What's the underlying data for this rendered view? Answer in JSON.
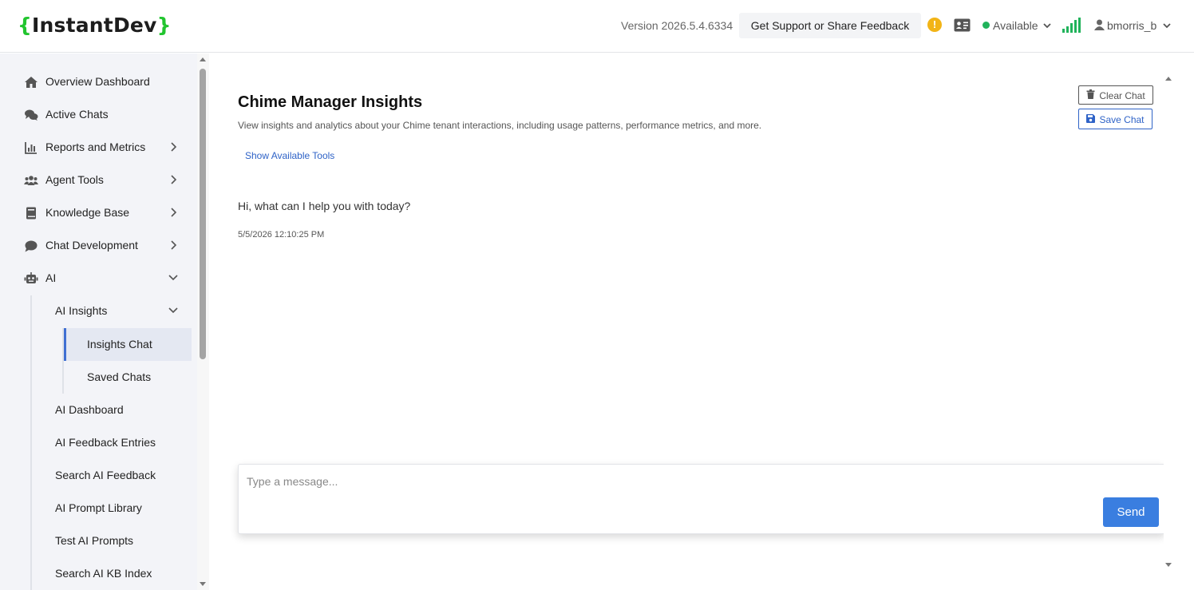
{
  "header": {
    "logo_open": "{",
    "logo_text": "InstantDev",
    "logo_close": "}",
    "version": "Version 2026.5.4.6334",
    "support_label": "Get Support or Share Feedback",
    "warn_glyph": "!",
    "status_label": "Available",
    "status_color": "#21b35b",
    "username": "bmorris_b"
  },
  "sidebar": {
    "items": [
      {
        "label": "Overview Dashboard",
        "icon": "home-icon"
      },
      {
        "label": "Active Chats",
        "icon": "chats-icon"
      },
      {
        "label": "Reports and Metrics",
        "icon": "chart-icon"
      },
      {
        "label": "Agent Tools",
        "icon": "users-icon"
      },
      {
        "label": "Knowledge Base",
        "icon": "book-icon"
      },
      {
        "label": "Chat Development",
        "icon": "comment-icon"
      },
      {
        "label": "AI",
        "icon": "robot-icon"
      }
    ],
    "ai_sub": {
      "insights_label": "AI Insights",
      "insights_children": [
        "Insights Chat",
        "Saved Chats"
      ],
      "others": [
        "AI Dashboard",
        "AI Feedback Entries",
        "Search AI Feedback",
        "AI Prompt Library",
        "Test AI Prompts",
        "Search AI KB Index"
      ]
    }
  },
  "main": {
    "title": "Chime Manager Insights",
    "subtitle": "View insights and analytics about your Chime tenant interactions, including usage patterns, performance metrics, and more.",
    "tools_link": "Show Available Tools",
    "clear_label": "Clear Chat",
    "save_label": "Save Chat",
    "message": "Hi, what can I help you with today?",
    "message_time": "5/5/2026 12:10:25 PM",
    "input_placeholder": "Type a message...",
    "send_label": "Send"
  }
}
